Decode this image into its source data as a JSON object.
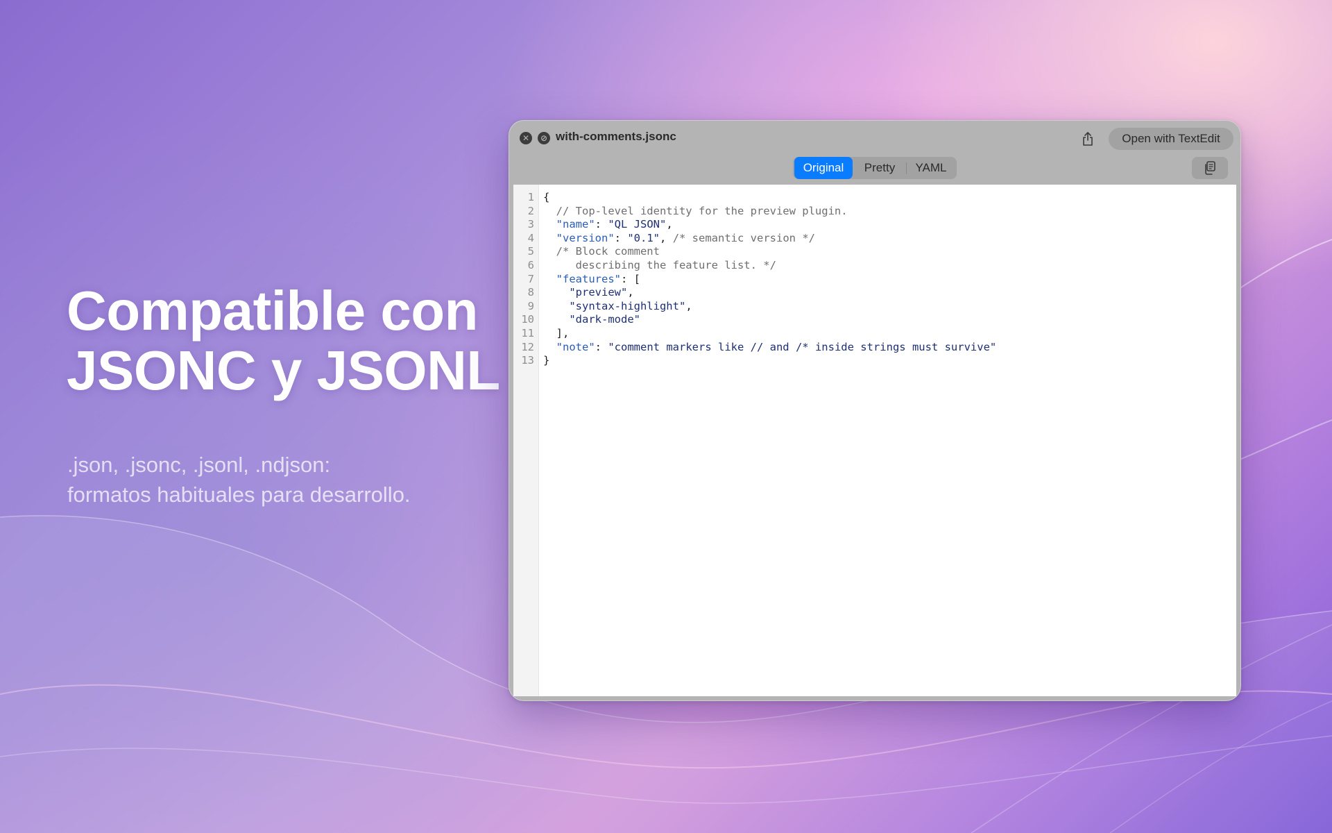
{
  "headline": {
    "line1": "Compatible con",
    "line2": "JSONC y JSONL"
  },
  "subline": {
    "line1": ".json, .jsonc, .jsonl, .ndjson:",
    "line2": "formatos habituales para desarrollo."
  },
  "window": {
    "filename": "with-comments.jsonc",
    "open_button": "Open with TextEdit",
    "tabs": [
      {
        "label": "Original",
        "active": true
      },
      {
        "label": "Pretty",
        "active": false
      },
      {
        "label": "YAML",
        "active": false
      }
    ],
    "icons": {
      "close": "close-icon",
      "block": "block-icon",
      "share": "share-icon",
      "copy": "copy-icon"
    }
  },
  "code": {
    "line_numbers": [
      "1",
      "2",
      "3",
      "4",
      "5",
      "6",
      "7",
      "8",
      "9",
      "10",
      "11",
      "12",
      "13"
    ],
    "lines": [
      [
        {
          "t": "{",
          "c": "p"
        }
      ],
      [
        {
          "t": "  // Top-level identity for the preview plugin.",
          "c": "c"
        }
      ],
      [
        {
          "t": "  ",
          "c": "p"
        },
        {
          "t": "\"name\"",
          "c": "k"
        },
        {
          "t": ": ",
          "c": "p"
        },
        {
          "t": "\"QL JSON\"",
          "c": "s"
        },
        {
          "t": ",",
          "c": "p"
        }
      ],
      [
        {
          "t": "  ",
          "c": "p"
        },
        {
          "t": "\"version\"",
          "c": "k"
        },
        {
          "t": ": ",
          "c": "p"
        },
        {
          "t": "\"0.1\"",
          "c": "s"
        },
        {
          "t": ", ",
          "c": "p"
        },
        {
          "t": "/* semantic version */",
          "c": "c"
        }
      ],
      [
        {
          "t": "  /* Block comment",
          "c": "c"
        }
      ],
      [
        {
          "t": "     describing the feature list. */",
          "c": "c"
        }
      ],
      [
        {
          "t": "  ",
          "c": "p"
        },
        {
          "t": "\"features\"",
          "c": "k"
        },
        {
          "t": ": [",
          "c": "p"
        }
      ],
      [
        {
          "t": "    ",
          "c": "p"
        },
        {
          "t": "\"preview\"",
          "c": "s"
        },
        {
          "t": ",",
          "c": "p"
        }
      ],
      [
        {
          "t": "    ",
          "c": "p"
        },
        {
          "t": "\"syntax-highlight\"",
          "c": "s"
        },
        {
          "t": ",",
          "c": "p"
        }
      ],
      [
        {
          "t": "    ",
          "c": "p"
        },
        {
          "t": "\"dark-mode\"",
          "c": "s"
        }
      ],
      [
        {
          "t": "  ],",
          "c": "p"
        }
      ],
      [
        {
          "t": "  ",
          "c": "p"
        },
        {
          "t": "\"note\"",
          "c": "k"
        },
        {
          "t": ": ",
          "c": "p"
        },
        {
          "t": "\"comment markers like // and /* inside strings must survive\"",
          "c": "s"
        }
      ],
      [
        {
          "t": "}",
          "c": "p"
        }
      ]
    ]
  },
  "colors": {
    "accent": "#0a7cff",
    "key": "#2b5cb8",
    "string": "#1e2f73",
    "comment": "#6f6f6f"
  }
}
